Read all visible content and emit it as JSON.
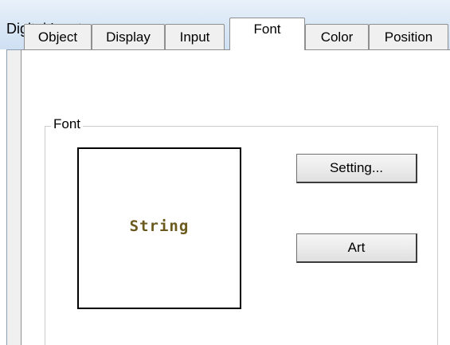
{
  "window": {
    "title": "Digital Input"
  },
  "tabs": [
    {
      "label": "Object",
      "selected": false
    },
    {
      "label": "Display",
      "selected": false
    },
    {
      "label": "Input",
      "selected": false
    },
    {
      "label": "Font",
      "selected": true
    },
    {
      "label": "Color",
      "selected": false
    },
    {
      "label": "Position",
      "selected": false
    }
  ],
  "font_group": {
    "label": "Font",
    "preview_text": "String",
    "preview_text_color": "#6b5a1e",
    "setting_button_label": "Setting...",
    "art_button_label": "Art"
  },
  "colors": {
    "titlebar": "#dbe8f6",
    "dialog_background": "#f0f0f0",
    "panel_background": "#ffffff"
  }
}
